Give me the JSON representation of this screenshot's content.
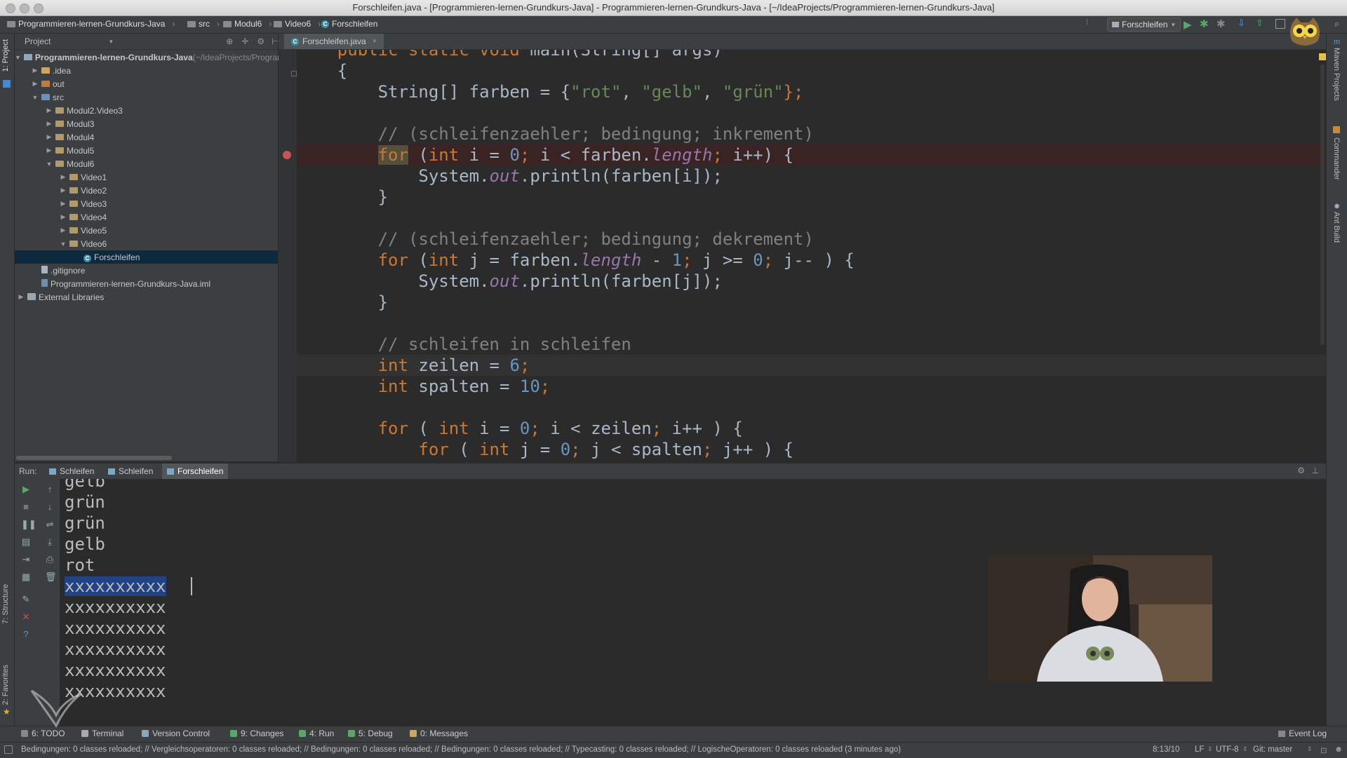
{
  "window": {
    "title": "Forschleifen.java - [Programmieren-lernen-Grundkurs-Java] - Programmieren-lernen-Grundkurs-Java - [~/IdeaProjects/Programmieren-lernen-Grundkurs-Java]"
  },
  "navbar": {
    "crumbs": [
      "Programmieren-lernen-Grundkurs-Java",
      "src",
      "Modul6",
      "Video6",
      "Forschleifen"
    ],
    "run_config": "Forschleifen"
  },
  "project_panel": {
    "header": "Project",
    "tree": [
      {
        "label": "Programmieren-lernen-Grundkurs-Java",
        "suffix": "(~/IdeaProjects/Programmieren-lernen-Grundkurs-Java)",
        "depth": 0,
        "state": "open",
        "icon": "module"
      },
      {
        "label": ".idea",
        "depth": 1,
        "state": "closed",
        "icon": "folder"
      },
      {
        "label": "out",
        "depth": 1,
        "state": "closed",
        "icon": "folder-orange"
      },
      {
        "label": "src",
        "depth": 1,
        "state": "open",
        "icon": "folder-src"
      },
      {
        "label": "Modul2.Video3",
        "depth": 2,
        "state": "closed",
        "icon": "package"
      },
      {
        "label": "Modul3",
        "depth": 2,
        "state": "closed",
        "icon": "package"
      },
      {
        "label": "Modul4",
        "depth": 2,
        "state": "closed",
        "icon": "package"
      },
      {
        "label": "Modul5",
        "depth": 2,
        "state": "closed",
        "icon": "package"
      },
      {
        "label": "Modul6",
        "depth": 2,
        "state": "open",
        "icon": "package"
      },
      {
        "label": "Video1",
        "depth": 3,
        "state": "closed",
        "icon": "package"
      },
      {
        "label": "Video2",
        "depth": 3,
        "state": "closed",
        "icon": "package"
      },
      {
        "label": "Video3",
        "depth": 3,
        "state": "closed",
        "icon": "package"
      },
      {
        "label": "Video4",
        "depth": 3,
        "state": "closed",
        "icon": "package"
      },
      {
        "label": "Video5",
        "depth": 3,
        "state": "closed",
        "icon": "package"
      },
      {
        "label": "Video6",
        "depth": 3,
        "state": "open",
        "icon": "package"
      },
      {
        "label": "Forschleifen",
        "depth": 4,
        "state": "leaf",
        "icon": "class",
        "selected": true
      },
      {
        "label": ".gitignore",
        "depth": 1,
        "state": "leaf",
        "icon": "file"
      },
      {
        "label": "Programmieren-lernen-Grundkurs-Java.iml",
        "depth": 1,
        "state": "leaf",
        "icon": "iml"
      },
      {
        "label": "External Libraries",
        "depth": 0,
        "state": "closed",
        "icon": "library"
      }
    ]
  },
  "editor": {
    "tab": "Forschleifen.java",
    "lines": [
      {
        "tokens": [
          [
            "    ",
            ""
          ],
          [
            "public static void ",
            "kw"
          ],
          [
            "main(String[] args)",
            ""
          ]
        ]
      },
      {
        "tokens": [
          [
            "    {",
            ""
          ]
        ]
      },
      {
        "tokens": [
          [
            "        String[] farben = {",
            ""
          ],
          [
            "\"rot\"",
            "str"
          ],
          [
            ", ",
            ""
          ],
          [
            "\"gelb\"",
            "str"
          ],
          [
            ", ",
            ""
          ],
          [
            "\"grün\"",
            "str"
          ],
          [
            "};",
            "kw"
          ]
        ]
      },
      {
        "tokens": [
          [
            "",
            ""
          ]
        ]
      },
      {
        "tokens": [
          [
            "        // (schleifenzaehler; bedingung; inkrement)",
            "cm"
          ]
        ]
      },
      {
        "tokens": [
          [
            "        ",
            ""
          ],
          [
            "for",
            "kw hl"
          ],
          [
            " (",
            ""
          ],
          [
            "int ",
            "kw"
          ],
          [
            "i = ",
            ""
          ],
          [
            "0",
            "num"
          ],
          [
            "; ",
            "kw"
          ],
          [
            "i < farben.",
            ""
          ],
          [
            "length",
            "fld"
          ],
          [
            "; ",
            "kw"
          ],
          [
            "i++) {",
            ""
          ]
        ],
        "breakpoint": true
      },
      {
        "tokens": [
          [
            "            System.",
            ""
          ],
          [
            "out",
            "fld"
          ],
          [
            ".println(farben[i]);",
            ""
          ]
        ]
      },
      {
        "tokens": [
          [
            "        }",
            ""
          ]
        ]
      },
      {
        "tokens": [
          [
            "",
            ""
          ]
        ]
      },
      {
        "tokens": [
          [
            "        // (schleifenzaehler; bedingung; dekrement)",
            "cm"
          ]
        ]
      },
      {
        "tokens": [
          [
            "        ",
            ""
          ],
          [
            "for",
            "kw"
          ],
          [
            " (",
            ""
          ],
          [
            "int ",
            "kw"
          ],
          [
            "j = farben.",
            ""
          ],
          [
            "length",
            "fld"
          ],
          [
            " - ",
            ""
          ],
          [
            "1",
            "num"
          ],
          [
            "; ",
            "kw"
          ],
          [
            "j >= ",
            ""
          ],
          [
            "0",
            "num"
          ],
          [
            "; ",
            "kw"
          ],
          [
            "j-- ) {",
            ""
          ]
        ]
      },
      {
        "tokens": [
          [
            "            System.",
            ""
          ],
          [
            "out",
            "fld"
          ],
          [
            ".println(farben[j]);",
            ""
          ]
        ]
      },
      {
        "tokens": [
          [
            "        }",
            ""
          ]
        ]
      },
      {
        "tokens": [
          [
            "",
            ""
          ]
        ]
      },
      {
        "tokens": [
          [
            "        // schleifen in schleifen",
            "cm"
          ]
        ]
      },
      {
        "tokens": [
          [
            "        ",
            ""
          ],
          [
            "int ",
            "kw"
          ],
          [
            "zeilen = ",
            ""
          ],
          [
            "6",
            "num"
          ],
          [
            ";",
            "kw"
          ]
        ],
        "current": true
      },
      {
        "tokens": [
          [
            "        ",
            ""
          ],
          [
            "int ",
            "kw"
          ],
          [
            "spalten = ",
            ""
          ],
          [
            "10",
            "num"
          ],
          [
            ";",
            "kw"
          ]
        ]
      },
      {
        "tokens": [
          [
            "",
            ""
          ]
        ]
      },
      {
        "tokens": [
          [
            "        ",
            ""
          ],
          [
            "for",
            "kw"
          ],
          [
            " ( ",
            ""
          ],
          [
            "int ",
            "kw"
          ],
          [
            "i = ",
            ""
          ],
          [
            "0",
            "num"
          ],
          [
            "; ",
            "kw"
          ],
          [
            "i < zeilen",
            ""
          ],
          [
            "; ",
            "kw"
          ],
          [
            "i++ ) {",
            ""
          ]
        ]
      },
      {
        "tokens": [
          [
            "            ",
            ""
          ],
          [
            "for",
            "kw"
          ],
          [
            " ( ",
            ""
          ],
          [
            "int ",
            "kw"
          ],
          [
            "j = ",
            ""
          ],
          [
            "0",
            "num"
          ],
          [
            "; ",
            "kw"
          ],
          [
            "j < spalten",
            ""
          ],
          [
            "; ",
            "kw"
          ],
          [
            "j++ ) {",
            ""
          ]
        ]
      }
    ]
  },
  "run_panel": {
    "label": "Run:",
    "tabs": [
      "Schleifen",
      "Schleifen",
      "Forschleifen"
    ],
    "active_tab": 2,
    "output": [
      "gelb",
      "grün",
      "grün",
      "gelb",
      "rot",
      "xxxxxxxxxx",
      "xxxxxxxxxx",
      "xxxxxxxxxx",
      "xxxxxxxxxx",
      "xxxxxxxxxx",
      "xxxxxxxxxx"
    ],
    "selected_line": 5
  },
  "side_tabs": {
    "left": [
      "1: Project",
      "7: Structure",
      "2: Favorites"
    ],
    "right": [
      "Maven Projects",
      "Commander",
      "Ant Build"
    ]
  },
  "toolwindows": [
    {
      "label": "6: TODO",
      "icon": "todo-icon"
    },
    {
      "label": "Terminal",
      "icon": "terminal-icon"
    },
    {
      "label": "Version Control",
      "icon": "vcs-icon"
    },
    {
      "label": "9: Changes",
      "icon": "changes-icon"
    },
    {
      "label": "4: Run",
      "icon": "run-icon"
    },
    {
      "label": "5: Debug",
      "icon": "debug-icon"
    },
    {
      "label": "0: Messages",
      "icon": "messages-icon"
    }
  ],
  "event_log": "Event Log",
  "status": {
    "message": "Bedingungen: 0 classes reloaded; // Vergleichsoperatoren: 0 classes reloaded; // Bedingungen: 0 classes reloaded; // Bedingungen: 0 classes reloaded; // Typecasting: 0 classes reloaded; // LogischeOperatoren: 0 classes reloaded (3 minutes ago)",
    "position": "8:13/10",
    "line_sep": "LF",
    "encoding": "UTF-8",
    "git": "Git: master"
  },
  "colors": {
    "bg": "#2b2b2b",
    "panel": "#3c3f41",
    "keyword": "#cc7832",
    "string": "#6a8759",
    "number": "#6897bb",
    "comment": "#808080",
    "field": "#9876aa",
    "selection": "#214283"
  }
}
